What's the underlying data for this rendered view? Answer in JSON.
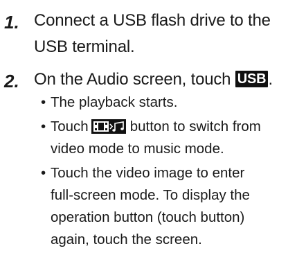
{
  "steps": [
    {
      "number": "1.",
      "lines": [
        "Connect a USB flash drive to the",
        "USB terminal."
      ]
    },
    {
      "number": "2.",
      "text_before": "On the Audio screen, touch ",
      "key_label": "USB",
      "text_after": ".",
      "bullets": [
        {
          "dot": "•",
          "lines": [
            "The playback starts."
          ]
        },
        {
          "dot": "•",
          "before_icon": "Touch",
          "icon": "video-music-switch-icon",
          "after_icon": "button to switch from",
          "lines": [
            "video mode to music mode."
          ]
        },
        {
          "dot": "•",
          "lines": [
            "Touch the video image to enter",
            "full-screen mode. To display the",
            "operation button (touch button)",
            "again, touch the screen."
          ]
        }
      ]
    }
  ],
  "colors": {
    "text": "#1a1a1a",
    "key_bg": "#111111",
    "key_fg": "#ffffff"
  }
}
